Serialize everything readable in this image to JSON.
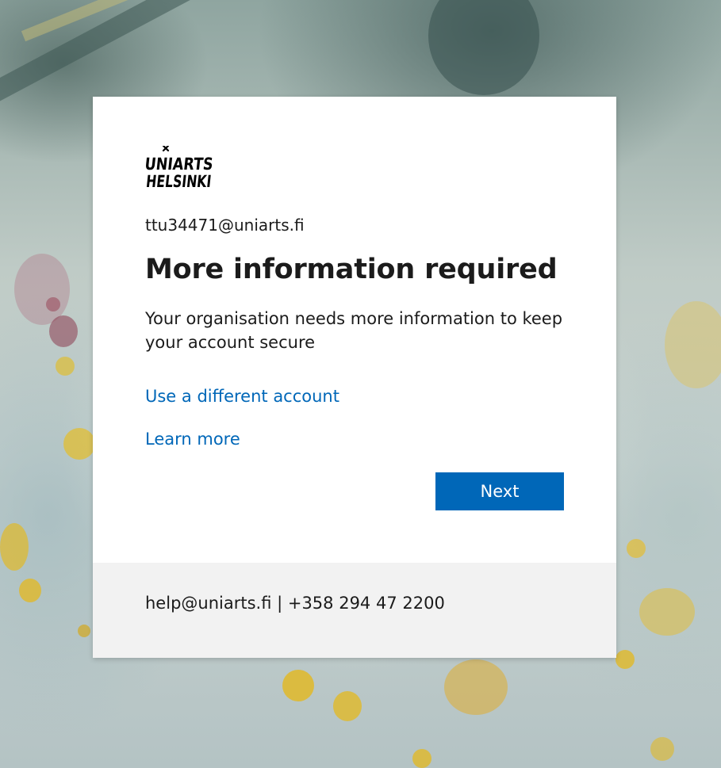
{
  "brand": {
    "logo_line1": "UNIARTS",
    "logo_line2": "HELSINKI"
  },
  "signin": {
    "user_email": "ttu34471@uniarts.fi",
    "title": "More information required",
    "description": "Your organisation needs more information to keep your account secure",
    "different_account_link": "Use a different account",
    "learn_more_link": "Learn more",
    "next_button": "Next"
  },
  "footer": {
    "contact": "help@uniarts.fi | +358 294 47 2200"
  },
  "colors": {
    "accent": "#0067b8",
    "card": "#ffffff",
    "footer_bg": "#f2f2f2",
    "text": "#1b1b1b"
  },
  "icons": {
    "logo": "uniarts-helsinki-logo"
  }
}
